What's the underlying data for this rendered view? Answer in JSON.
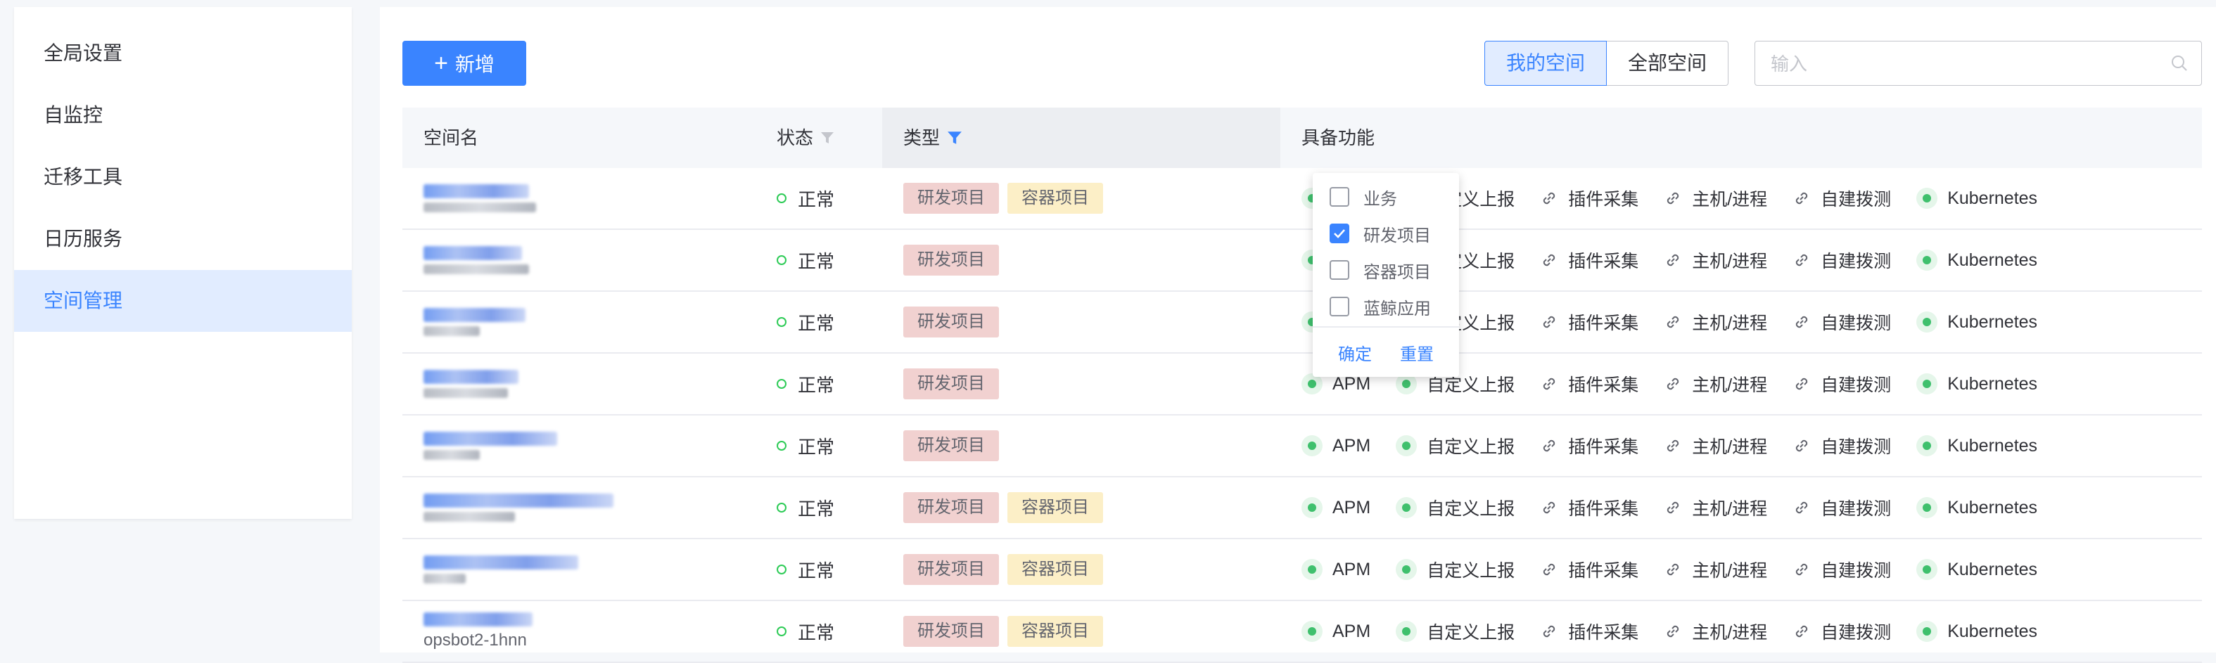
{
  "sidebar": {
    "items": [
      {
        "label": "全局设置",
        "active": false
      },
      {
        "label": "自监控",
        "active": false
      },
      {
        "label": "迁移工具",
        "active": false
      },
      {
        "label": "日历服务",
        "active": false
      },
      {
        "label": "空间管理",
        "active": true
      }
    ]
  },
  "toolbar": {
    "add_label": "新增",
    "my_space_label": "我的空间",
    "all_space_label": "全部空间",
    "search_placeholder": "输入"
  },
  "table": {
    "headers": {
      "name": "空间名",
      "status": "状态",
      "type": "类型",
      "features": "具备功能"
    },
    "rows": [
      {
        "name": "",
        "status": "正常",
        "tags": [
          "研发项目",
          "容器项目"
        ]
      },
      {
        "name": "",
        "status": "正常",
        "tags": [
          "研发项目"
        ]
      },
      {
        "name": "",
        "status": "正常",
        "tags": [
          "研发项目"
        ]
      },
      {
        "name": "",
        "status": "正常",
        "tags": [
          "研发项目"
        ]
      },
      {
        "name": "",
        "status": "正常",
        "tags": [
          "研发项目"
        ]
      },
      {
        "name": "",
        "status": "正常",
        "tags": [
          "研发项目",
          "容器项目"
        ]
      },
      {
        "name": "",
        "status": "正常",
        "tags": [
          "研发项目",
          "容器项目"
        ]
      },
      {
        "name": "opsbot2-1hnn",
        "status": "正常",
        "tags": [
          "研发项目",
          "容器项目"
        ]
      }
    ],
    "features": [
      {
        "label": "APM",
        "icon": "status-dot-icon"
      },
      {
        "label": "自定义上报",
        "icon": "status-dot-icon"
      },
      {
        "label": "插件采集",
        "icon": "link-icon"
      },
      {
        "label": "主机/进程",
        "icon": "link-icon"
      },
      {
        "label": "自建拨测",
        "icon": "link-icon"
      },
      {
        "label": "Kubernetes",
        "icon": "status-dot-icon"
      }
    ]
  },
  "type_filter": {
    "options": [
      {
        "label": "业务",
        "checked": false
      },
      {
        "label": "研发项目",
        "checked": true
      },
      {
        "label": "容器项目",
        "checked": false
      },
      {
        "label": "蓝鲸应用",
        "checked": false
      }
    ],
    "confirm_label": "确定",
    "reset_label": "重置"
  },
  "colors": {
    "accent": "#3a84ff",
    "status_ok": "#2dcb56",
    "tag_rd_bg": "#f1d1d0",
    "tag_container_bg": "#fcefc7"
  }
}
